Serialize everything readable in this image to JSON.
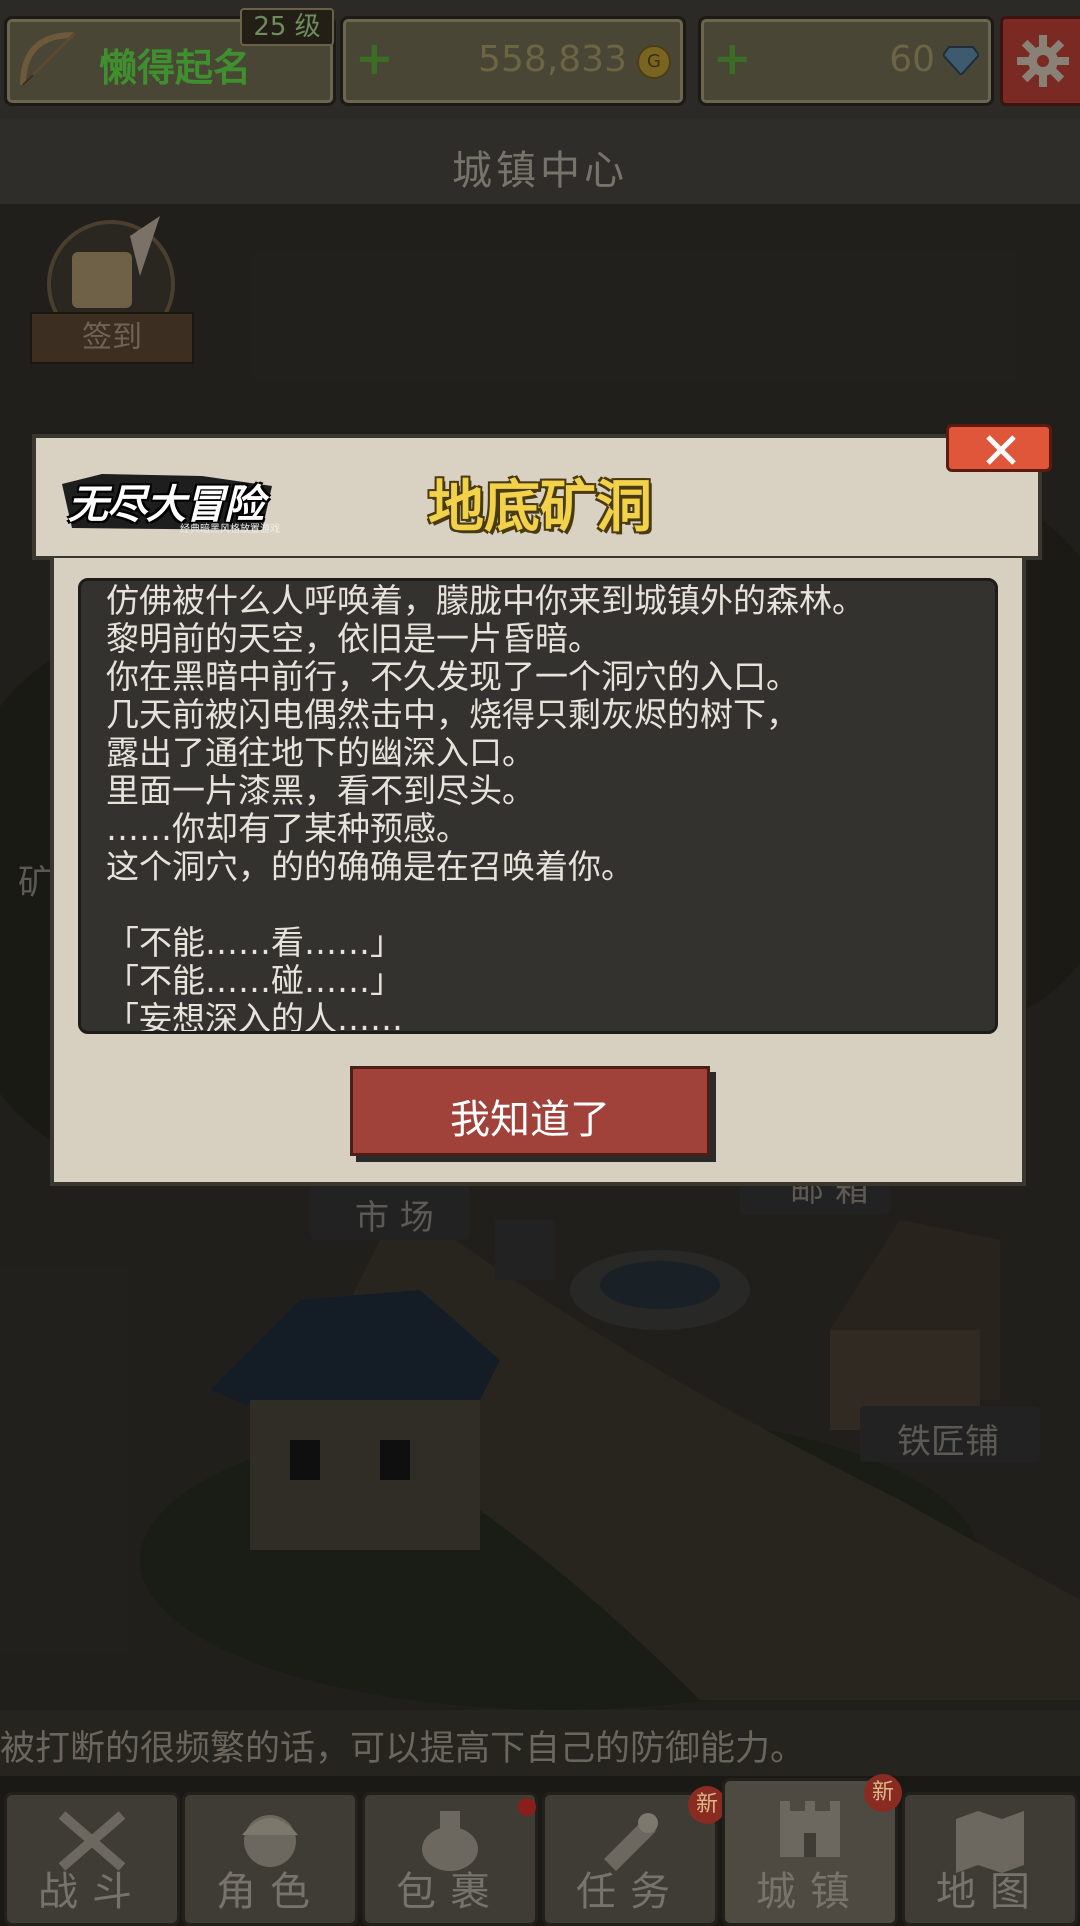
{
  "player": {
    "name": "懒得起名",
    "level": "25 级"
  },
  "currency": {
    "gold": "558,833",
    "gems": "60"
  },
  "screen_title": "城镇中心",
  "signin_label": "签到",
  "map_labels": {
    "mine": "矿",
    "market": "市 场",
    "mailbox": "邮 箱",
    "blacksmith": "铁匠铺"
  },
  "tip": "被打断的很频繁的话，可以提高下自己的防御能力。",
  "nav": [
    {
      "label": "战斗",
      "icon": "crossed-swords-icon"
    },
    {
      "label": "角色",
      "icon": "character-face-icon"
    },
    {
      "label": "包裹",
      "icon": "bag-icon"
    },
    {
      "label": "任务",
      "icon": "quest-icon"
    },
    {
      "label": "城镇",
      "icon": "castle-icon"
    },
    {
      "label": "地图",
      "icon": "map-icon"
    }
  ],
  "badges": {
    "new": "新"
  },
  "modal": {
    "logo_text": "无尽大冒险",
    "logo_sub": "经典暗黑风格放置游戏",
    "title": "地底矿洞",
    "story_lines": [
      "仿佛被什么人呼唤着，朦胧中你来到城镇外的森林。",
      "黎明前的天空，依旧是一片昏暗。",
      "你在黑暗中前行，不久发现了一个洞穴的入口。",
      "几天前被闪电偶然击中，烧得只剩灰烬的树下，",
      "露出了通往地下的幽深入口。",
      "里面一片漆黑，看不到尽头。",
      "……你却有了某种预感。",
      "这个洞穴，的的确确是在召唤着你。",
      "",
      "「不能……看……」",
      "「不能……碰……」",
      "「妄想深入的人……"
    ],
    "confirm_label": "我知道了"
  }
}
